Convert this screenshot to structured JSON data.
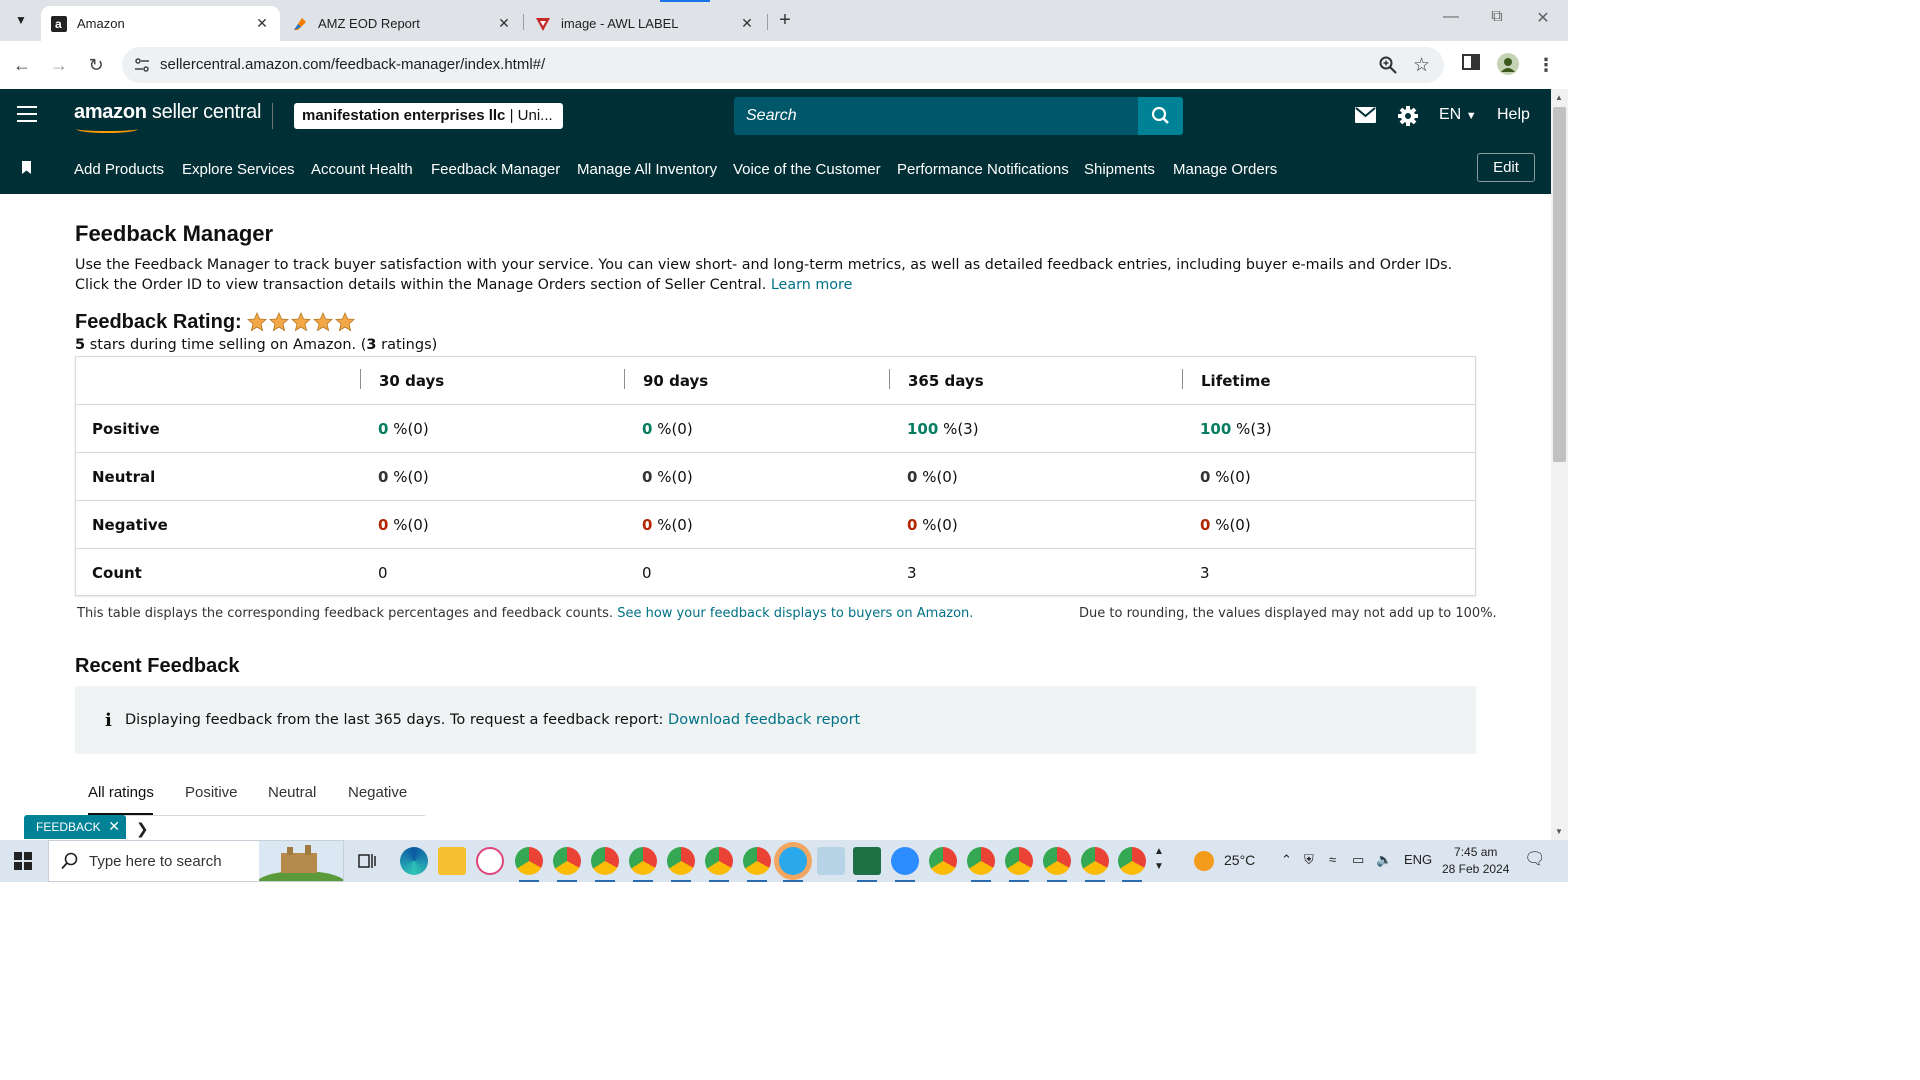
{
  "browser": {
    "tabs": [
      {
        "label": "Amazon",
        "active": true
      },
      {
        "label": "AMZ EOD Report",
        "active": false
      },
      {
        "label": "image - AWL LABEL",
        "active": false
      }
    ],
    "url": "sellercentral.amazon.com/feedback-manager/index.html#/"
  },
  "header": {
    "logo_bold": "amazon",
    "logo_rest": " seller central",
    "account_bold": "manifestation enterprises llc",
    "account_rest": " | Uni...",
    "search_placeholder": "Search",
    "language": "EN",
    "help": "Help"
  },
  "nav": {
    "links": [
      "Add Products",
      "Explore Services",
      "Account Health",
      "Feedback Manager",
      "Manage All Inventory",
      "Voice of the Customer",
      "Performance Notifications",
      "Shipments",
      "Manage Orders"
    ],
    "edit": "Edit"
  },
  "page": {
    "title": "Feedback Manager",
    "intro": "Use the Feedback Manager to track buyer satisfaction with your service. You can view short- and long-term metrics, as well as detailed feedback entries, including buyer e-mails and Order IDs. Click the Order ID to view transaction details within the Manage Orders section of Seller Central.",
    "learn_more": "Learn more",
    "rating_title": "Feedback Rating:",
    "rating_stars": 5,
    "rating_sub_value": "5",
    "rating_sub_mid": " stars during time selling on Amazon. (",
    "rating_sub_count": "3",
    "rating_sub_end": " ratings)"
  },
  "table": {
    "columns": [
      "30 days",
      "90 days",
      "365 days",
      "Lifetime"
    ],
    "rows": [
      {
        "label": "Positive",
        "cells": [
          {
            "v": "0",
            "s": " %(0)"
          },
          {
            "v": "0",
            "s": " %(0)"
          },
          {
            "v": "100",
            "s": " %(3)"
          },
          {
            "v": "100",
            "s": " %(3)"
          }
        ]
      },
      {
        "label": "Neutral",
        "cells": [
          {
            "v": "0",
            "s": " %(0)"
          },
          {
            "v": "0",
            "s": " %(0)"
          },
          {
            "v": "0",
            "s": " %(0)"
          },
          {
            "v": "0",
            "s": " %(0)"
          }
        ]
      },
      {
        "label": "Negative",
        "cells": [
          {
            "v": "0",
            "s": " %(0)"
          },
          {
            "v": "0",
            "s": " %(0)"
          },
          {
            "v": "0",
            "s": " %(0)"
          },
          {
            "v": "0",
            "s": " %(0)"
          }
        ]
      },
      {
        "label": "Count",
        "cells": [
          {
            "v": "0",
            "s": ""
          },
          {
            "v": "0",
            "s": ""
          },
          {
            "v": "3",
            "s": ""
          },
          {
            "v": "3",
            "s": ""
          }
        ]
      }
    ],
    "footnote": "This table displays the corresponding feedback percentages and feedback counts.",
    "footnote_link": "See how your feedback displays to buyers on Amazon.",
    "rounding_note": "Due to rounding, the values displayed may not add up to 100%."
  },
  "recent": {
    "title": "Recent Feedback",
    "info": "Displaying feedback from the last 365 days. To request a feedback report:",
    "info_link": "Download feedback report",
    "tabs": [
      "All ratings",
      "Positive",
      "Neutral",
      "Negative"
    ],
    "feedback_pill": "FEEDBACK"
  },
  "taskbar": {
    "search_placeholder": "Type here to search",
    "temperature": "25°C",
    "language": "ENG",
    "time": "7:45 am",
    "date": "28 Feb 2024"
  },
  "colors": {
    "header_bg": "#002f36",
    "link": "#007185",
    "positive": "#067d62",
    "negative": "#b12704",
    "star": "#f3a847"
  }
}
